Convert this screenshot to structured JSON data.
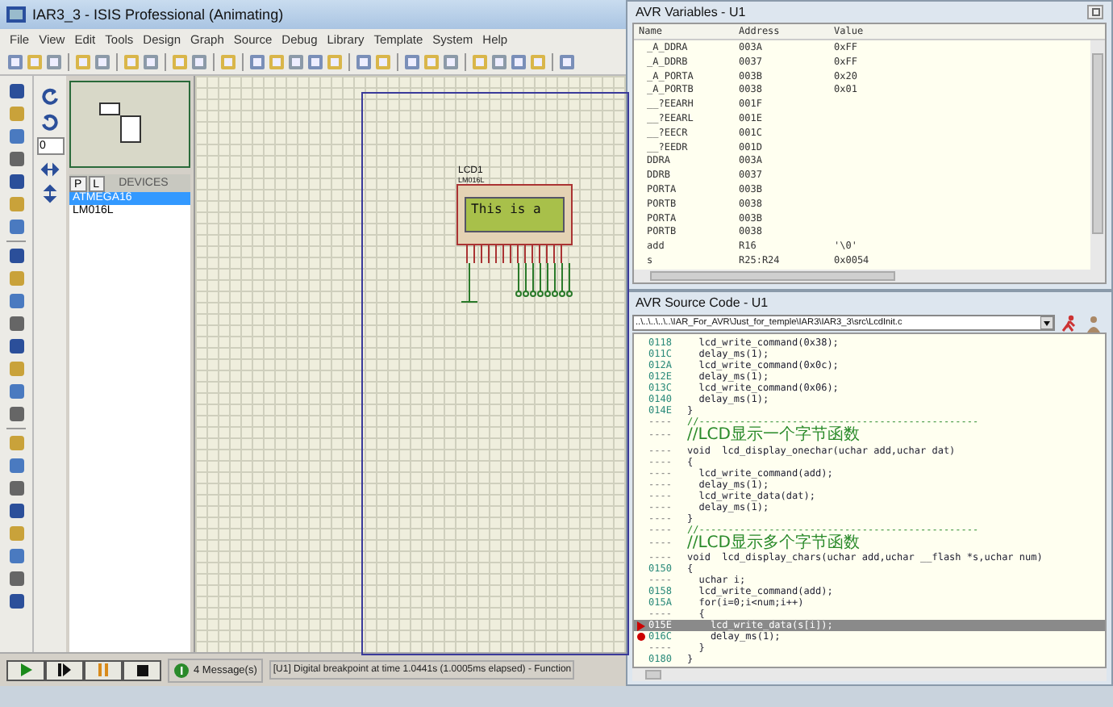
{
  "window": {
    "title": "IAR3_3 - ISIS Professional (Animating)"
  },
  "menu": [
    "File",
    "View",
    "Edit",
    "Tools",
    "Design",
    "Graph",
    "Source",
    "Debug",
    "Library",
    "Template",
    "System",
    "Help"
  ],
  "rotation": {
    "value": "0"
  },
  "devices": {
    "tabs": [
      "P",
      "L"
    ],
    "header": "DEVICES",
    "items": [
      {
        "label": "ATMEGA16",
        "selected": true
      },
      {
        "label": "LM016L",
        "selected": false
      }
    ]
  },
  "schematic": {
    "lcd": {
      "ref": "LCD1",
      "part": "LM016L",
      "display": "This is a"
    }
  },
  "sim_controls": {
    "messages": "4 Message(s)",
    "status": "[U1] Digital breakpoint at time 1.0441s (1.0005ms elapsed) - Function"
  },
  "variables": {
    "title": "AVR Variables - U1",
    "columns": [
      "Name",
      "Address",
      "Value"
    ],
    "rows": [
      [
        "_A_DDRA",
        "003A",
        "0xFF"
      ],
      [
        "_A_DDRB",
        "0037",
        "0xFF"
      ],
      [
        "_A_PORTA",
        "003B",
        "0x20"
      ],
      [
        "_A_PORTB",
        "0038",
        "0x01"
      ],
      [
        "__?EEARH",
        "001F",
        ""
      ],
      [
        "__?EEARL",
        "001E",
        ""
      ],
      [
        "__?EECR",
        "001C",
        ""
      ],
      [
        "__?EEDR",
        "001D",
        ""
      ],
      [
        "DDRA",
        "003A",
        ""
      ],
      [
        "DDRB",
        "0037",
        ""
      ],
      [
        "PORTA",
        "003B",
        ""
      ],
      [
        "PORTB",
        "0038",
        ""
      ],
      [
        "PORTA",
        "003B",
        ""
      ],
      [
        "PORTB",
        "0038",
        ""
      ],
      [
        "add",
        "R16",
        "'\\0'"
      ],
      [
        "s",
        "R25:R24",
        "0x0054"
      ]
    ]
  },
  "source": {
    "title": "AVR Source Code - U1",
    "path": "..\\..\\..\\..\\..\\IAR_For_AVR\\Just_for_temple\\IAR3\\IAR3_3\\src\\LcdInit.c",
    "lines": [
      {
        "addr": "0118",
        "code": "  lcd_write_command(0x38);",
        "kind": "code"
      },
      {
        "addr": "011C",
        "code": "  delay_ms(1);",
        "kind": "code"
      },
      {
        "addr": "012A",
        "code": "  lcd_write_command(0x0c);",
        "kind": "code"
      },
      {
        "addr": "012E",
        "code": "  delay_ms(1);",
        "kind": "code"
      },
      {
        "addr": "013C",
        "code": "  lcd_write_command(0x06);",
        "kind": "code"
      },
      {
        "addr": "0140",
        "code": "  delay_ms(1);",
        "kind": "code"
      },
      {
        "addr": "014E",
        "code": "}",
        "kind": "code"
      },
      {
        "addr": "----",
        "code": "//------------------------------------------------",
        "kind": "comment"
      },
      {
        "addr": "----",
        "code": "//LCD显示一个字节函数",
        "kind": "comment"
      },
      {
        "addr": "----",
        "code": "void  lcd_display_onechar(uchar add,uchar dat)",
        "kind": "code"
      },
      {
        "addr": "----",
        "code": "{",
        "kind": "code"
      },
      {
        "addr": "----",
        "code": "  lcd_write_command(add);",
        "kind": "code"
      },
      {
        "addr": "----",
        "code": "  delay_ms(1);",
        "kind": "code"
      },
      {
        "addr": "----",
        "code": "  lcd_write_data(dat);",
        "kind": "code"
      },
      {
        "addr": "----",
        "code": "  delay_ms(1);",
        "kind": "code"
      },
      {
        "addr": "----",
        "code": "}",
        "kind": "code"
      },
      {
        "addr": "----",
        "code": "//------------------------------------------------",
        "kind": "comment"
      },
      {
        "addr": "----",
        "code": "//LCD显示多个字节函数",
        "kind": "comment"
      },
      {
        "addr": "----",
        "code": "void  lcd_display_chars(uchar add,uchar __flash *s,uchar num)",
        "kind": "code"
      },
      {
        "addr": "0150",
        "code": "{",
        "kind": "code"
      },
      {
        "addr": "----",
        "code": "  uchar i;",
        "kind": "code"
      },
      {
        "addr": "0158",
        "code": "  lcd_write_command(add);",
        "kind": "code"
      },
      {
        "addr": "015A",
        "code": "  for(i=0;i<num;i++)",
        "kind": "code"
      },
      {
        "addr": "----",
        "code": "  {",
        "kind": "code"
      },
      {
        "addr": "015E",
        "code": "    lcd_write_data(s[i]);",
        "kind": "current"
      },
      {
        "addr": "016C",
        "code": "    delay_ms(1);",
        "kind": "breakpoint"
      },
      {
        "addr": "----",
        "code": "  }",
        "kind": "code"
      },
      {
        "addr": "0180",
        "code": "}",
        "kind": "code"
      }
    ]
  }
}
